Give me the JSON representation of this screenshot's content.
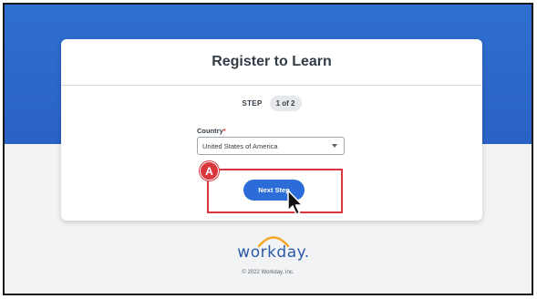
{
  "card": {
    "title": "Register to Learn",
    "step": {
      "label": "STEP",
      "progress": "1 of 2"
    }
  },
  "form": {
    "country": {
      "label": "Country",
      "required_mark": "*",
      "value": "United States of America"
    }
  },
  "actions": {
    "next_label": "Next Step"
  },
  "annotation": {
    "badge": "A",
    "color": "#d9363e"
  },
  "footer": {
    "logo_text": "workday.",
    "copyright": "© 2022 Workday, Inc."
  },
  "colors": {
    "banner": "#2962c4",
    "primary_button": "#2b6cd8",
    "logo_arc": "#f5a623"
  }
}
